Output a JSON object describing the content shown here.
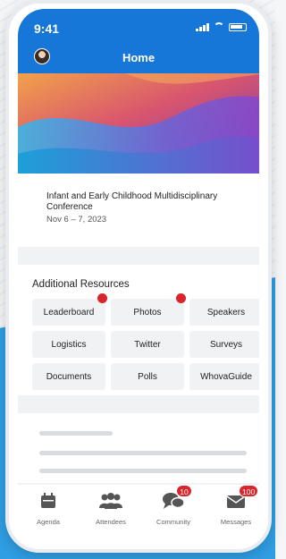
{
  "status_bar": {
    "time": "9:41"
  },
  "header": {
    "title": "Home",
    "avatar_icon": "user-avatar"
  },
  "event": {
    "title": "Infant and Early Childhood Multidisciplinary Conference",
    "date": "Nov 6 – 7, 2023"
  },
  "resources": {
    "title": "Additional Resources",
    "items": [
      {
        "label": "Leaderboard",
        "new": true
      },
      {
        "label": "Photos",
        "new": true
      },
      {
        "label": "Speakers",
        "new": false
      },
      {
        "label": "Logistics",
        "new": false
      },
      {
        "label": "Twitter",
        "new": false
      },
      {
        "label": "Surveys",
        "new": false
      },
      {
        "label": "Documents",
        "new": false
      },
      {
        "label": "Polls",
        "new": false
      },
      {
        "label": "WhovaGuide",
        "new": false
      }
    ]
  },
  "tabs": [
    {
      "label": "Agenda",
      "icon": "calendar-icon"
    },
    {
      "label": "Attendees",
      "icon": "people-icon"
    },
    {
      "label": "Community",
      "icon": "chat-bubbles-icon",
      "badge": "10"
    },
    {
      "label": "Messages",
      "icon": "envelope-icon",
      "badge": "100"
    }
  ],
  "colors": {
    "accent": "#1677d9",
    "badge": "#d9262c"
  }
}
